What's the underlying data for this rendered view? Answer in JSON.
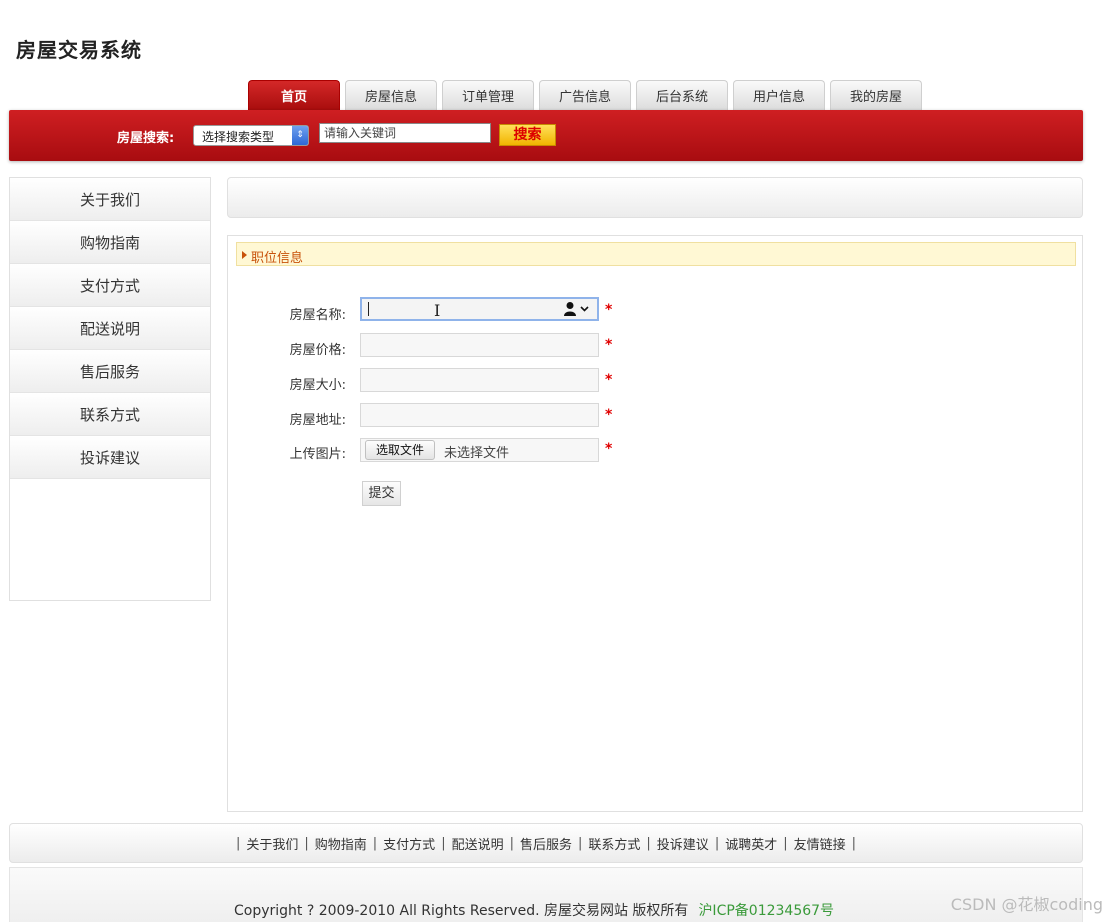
{
  "site": {
    "title": "房屋交易系统"
  },
  "nav": {
    "tabs": [
      "首页",
      "房屋信息",
      "订单管理",
      "广告信息",
      "后台系统",
      "用户信息",
      "我的房屋"
    ],
    "active_index": 0
  },
  "search": {
    "label": "房屋搜索:",
    "select_value": "选择搜索类型",
    "placeholder": "请输入关键词",
    "button_label": "搜索"
  },
  "sidebar": {
    "items": [
      "关于我们",
      "购物指南",
      "支付方式",
      "配送说明",
      "售后服务",
      "联系方式",
      "投诉建议"
    ]
  },
  "section": {
    "title": "职位信息"
  },
  "form": {
    "fields": [
      {
        "label": "房屋名称:",
        "value": ""
      },
      {
        "label": "房屋价格:",
        "value": ""
      },
      {
        "label": "房屋大小:",
        "value": ""
      },
      {
        "label": "房屋地址:",
        "value": ""
      }
    ],
    "upload": {
      "label": "上传图片:",
      "button_label": "选取文件",
      "status": "未选择文件"
    },
    "required_mark": "*",
    "submit_label": "提交"
  },
  "footer": {
    "links": [
      "关于我们",
      "购物指南",
      "支付方式",
      "配送说明",
      "售后服务",
      "联系方式",
      "投诉建议",
      "诚聘英才",
      "友情链接"
    ],
    "separator": "|",
    "copyright": "Copyright ? 2009-2010 All Rights Reserved. 房屋交易网站 版权所有",
    "icp": "沪ICP备01234567号"
  },
  "watermark": "CSDN @花椒coding",
  "colors": {
    "brand_red": "#c0161a",
    "search_button": "#f5c000",
    "section_text": "#c8520a",
    "required": "#e00000",
    "icp_green": "#3a9a3a"
  },
  "icons": {
    "select_arrow": "updown-arrows-icon",
    "section_marker": "triangle-right-icon",
    "autofill": "person-icon"
  }
}
